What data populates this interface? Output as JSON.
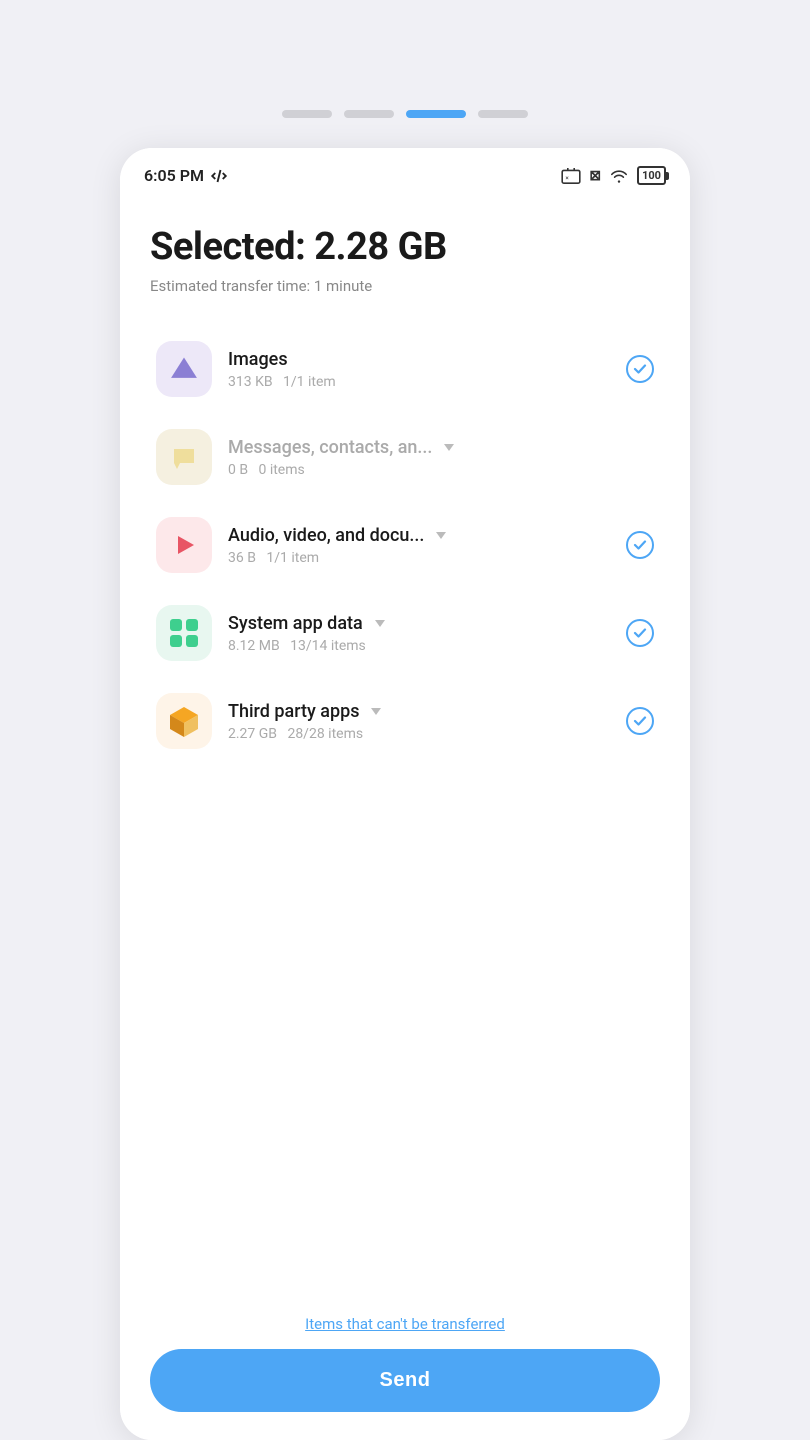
{
  "topIndicators": [
    {
      "id": "ind1",
      "active": false
    },
    {
      "id": "ind2",
      "active": false
    },
    {
      "id": "ind3",
      "active": true
    },
    {
      "id": "ind4",
      "active": false
    }
  ],
  "statusBar": {
    "time": "6:05 PM",
    "batteryLevel": "100"
  },
  "header": {
    "selectedTitle": "Selected: 2.28 GB",
    "estimatedTime": "Estimated transfer time: 1 minute"
  },
  "transferItems": [
    {
      "id": "images",
      "name": "Images",
      "size": "313 KB",
      "itemCount": "1/1 item",
      "checked": true,
      "dimmed": false,
      "hasChevron": false,
      "iconType": "images"
    },
    {
      "id": "messages",
      "name": "Messages, contacts, an...",
      "size": "0 B",
      "itemCount": "0 items",
      "checked": false,
      "dimmed": true,
      "hasChevron": true,
      "iconType": "messages"
    },
    {
      "id": "audio",
      "name": "Audio, video, and docu...",
      "size": "36 B",
      "itemCount": "1/1 item",
      "checked": true,
      "dimmed": false,
      "hasChevron": true,
      "iconType": "audio"
    },
    {
      "id": "system",
      "name": "System app data",
      "size": "8.12 MB",
      "itemCount": "13/14 items",
      "checked": true,
      "dimmed": false,
      "hasChevron": true,
      "iconType": "system"
    },
    {
      "id": "thirdparty",
      "name": "Third party apps",
      "size": "2.27 GB",
      "itemCount": "28/28 items",
      "checked": true,
      "dimmed": false,
      "hasChevron": true,
      "iconType": "thirdparty"
    }
  ],
  "footer": {
    "cantTransferText": "Items that can't be transferred",
    "sendLabel": "Send"
  },
  "colors": {
    "accent": "#4da6f5",
    "checkBorder": "#4da6f5"
  }
}
